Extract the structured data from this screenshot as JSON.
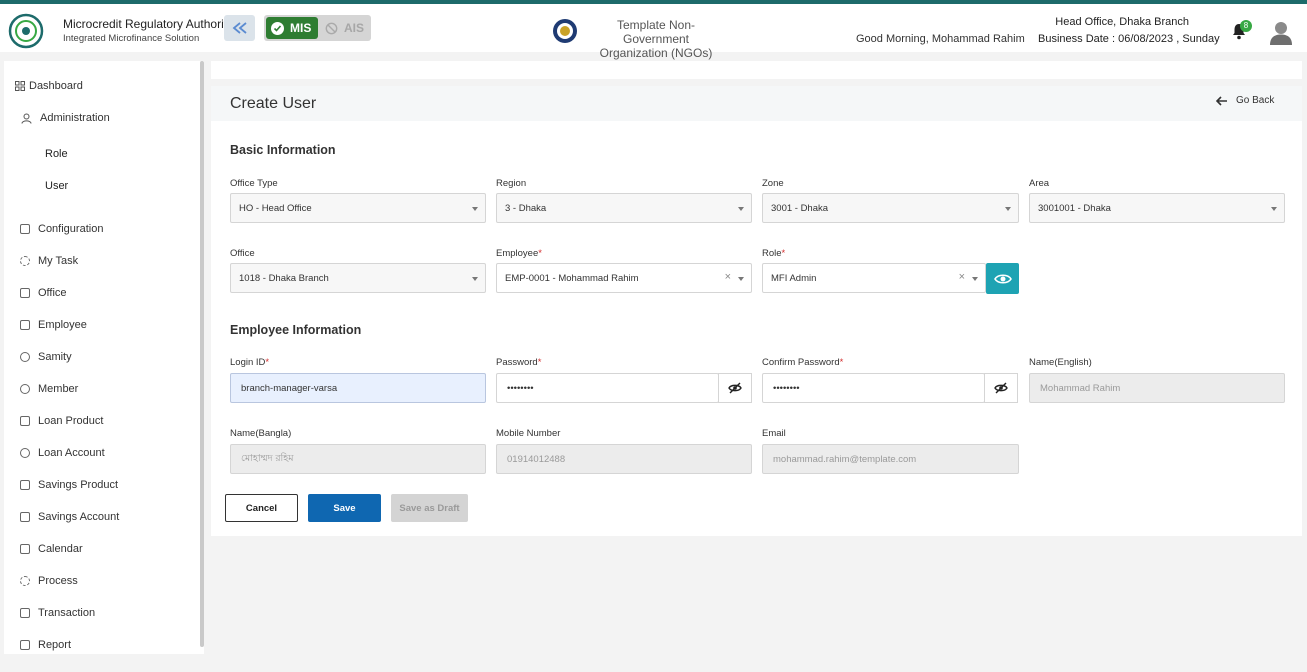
{
  "header": {
    "org_title": "Microcredit Regulatory Authority",
    "org_subtitle": "Integrated Microfinance Solution",
    "logo_text": "Microcredit Regulatory Authority",
    "mode_active": "MIS",
    "mode_inactive": "AIS",
    "ngo_line1": "Template Non-Government",
    "ngo_line2": "Organization (NGOs)",
    "greeting": "Good Morning, Mohammad Rahim",
    "branch": "Head Office, Dhaka Branch",
    "business_date": "Business Date : 06/08/2023 , Sunday",
    "notification_count": "8",
    "accent_color": "#2e7d32",
    "top_line_color": "#1d6b6b"
  },
  "sidebar": {
    "dashboard": "Dashboard",
    "administration": "Administration",
    "sub_items": [
      "Role",
      "User"
    ],
    "items": [
      "Configuration",
      "My Task",
      "Office",
      "Employee",
      "Samity",
      "Member",
      "Loan Product",
      "Loan Account",
      "Savings Product",
      "Savings Account",
      "Calendar",
      "Process",
      "Transaction",
      "Report"
    ]
  },
  "page": {
    "title": "Create User",
    "go_back": "Go Back"
  },
  "basic_info": {
    "section_title": "Basic Information",
    "office_type_label": "Office Type",
    "office_type_value": "HO - Head Office",
    "region_label": "Region",
    "region_value": "3 - Dhaka",
    "zone_label": "Zone",
    "zone_value": "3001 - Dhaka",
    "area_label": "Area",
    "area_value": "3001001 - Dhaka",
    "office_label": "Office",
    "office_value": "1018 - Dhaka Branch",
    "employee_label": "Employee",
    "employee_value": "EMP-0001 - Mohammad Rahim",
    "role_label": "Role",
    "role_value": "MFI Admin"
  },
  "employee_info": {
    "section_title": "Employee Information",
    "login_label": "Login ID",
    "login_value": "branch-manager-varsa",
    "password_label": "Password",
    "password_value": "••••••••",
    "confirm_label": "Confirm Password",
    "confirm_value": "••••••••",
    "name_en_label": "Name(English)",
    "name_en_value": "Mohammad Rahim",
    "name_bn_label": "Name(Bangla)",
    "name_bn_value": "মোহাম্মদ রহিম",
    "mobile_label": "Mobile Number",
    "mobile_value": "01914012488",
    "email_label": "Email",
    "email_value": "mohammad.rahim@template.com"
  },
  "actions": {
    "cancel": "Cancel",
    "save": "Save",
    "draft": "Save as Draft",
    "save_color": "#0f67b1"
  }
}
